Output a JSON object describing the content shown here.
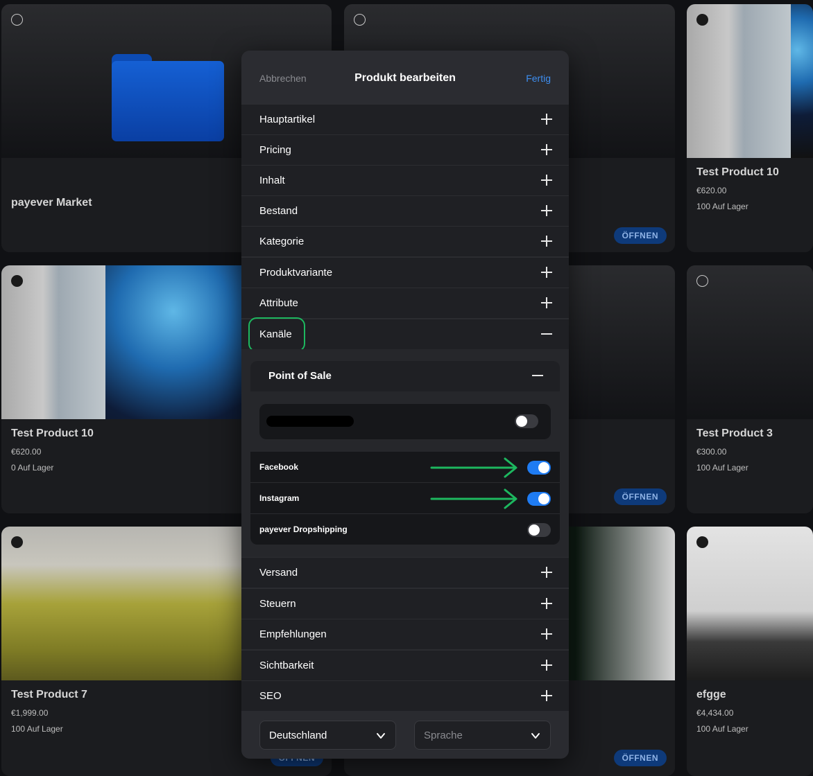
{
  "background": {
    "cards": [
      {
        "title": "payever Market",
        "price": "",
        "stock": "",
        "open": ""
      },
      {
        "title": "",
        "price": "",
        "stock": "",
        "open": "ÖFFNEN"
      },
      {
        "title": "Test Product 10",
        "price": "€620.00",
        "stock": "100 Auf Lager",
        "open": ""
      },
      {
        "title": "Test Product 10",
        "price": "€620.00",
        "stock": "0 Auf Lager",
        "open": ""
      },
      {
        "title": "",
        "price": "",
        "stock": "",
        "open": "ÖFFNEN"
      },
      {
        "title": "Test Product 3",
        "price": "€300.00",
        "stock": "100 Auf Lager",
        "open": ""
      },
      {
        "title": "Test Product 7",
        "price": "€1,999.00",
        "stock": "100 Auf Lager",
        "open": "ÖFFNEN"
      },
      {
        "title": "",
        "price": "",
        "stock": "",
        "open": "ÖFFNEN"
      },
      {
        "title": "efgge",
        "price": "€4,434.00",
        "stock": "100 Auf Lager",
        "open": ""
      }
    ]
  },
  "modal": {
    "cancel": "Abbrechen",
    "title": "Produkt bearbeiten",
    "done": "Fertig",
    "sections_top": [
      "Hauptartikel",
      "Pricing",
      "Inhalt",
      "Bestand",
      "Kategorie",
      "Produktvariante",
      "Attribute",
      "Kanäle"
    ],
    "channels": {
      "pos_label": "Point of Sale",
      "pos_toggle_on": false,
      "items": [
        {
          "label": "Facebook",
          "on": true
        },
        {
          "label": "Instagram",
          "on": true
        },
        {
          "label": "payever Dropshipping",
          "on": false
        }
      ]
    },
    "sections_bottom": [
      "Versand",
      "Steuern",
      "Empfehlungen",
      "Sichtbarkeit",
      "SEO"
    ],
    "country": "Deutschland",
    "language_placeholder": "Sprache"
  },
  "colors": {
    "accent": "#1f7cf3",
    "highlight": "#1db85f",
    "open_badge": "#0e3a7a"
  }
}
